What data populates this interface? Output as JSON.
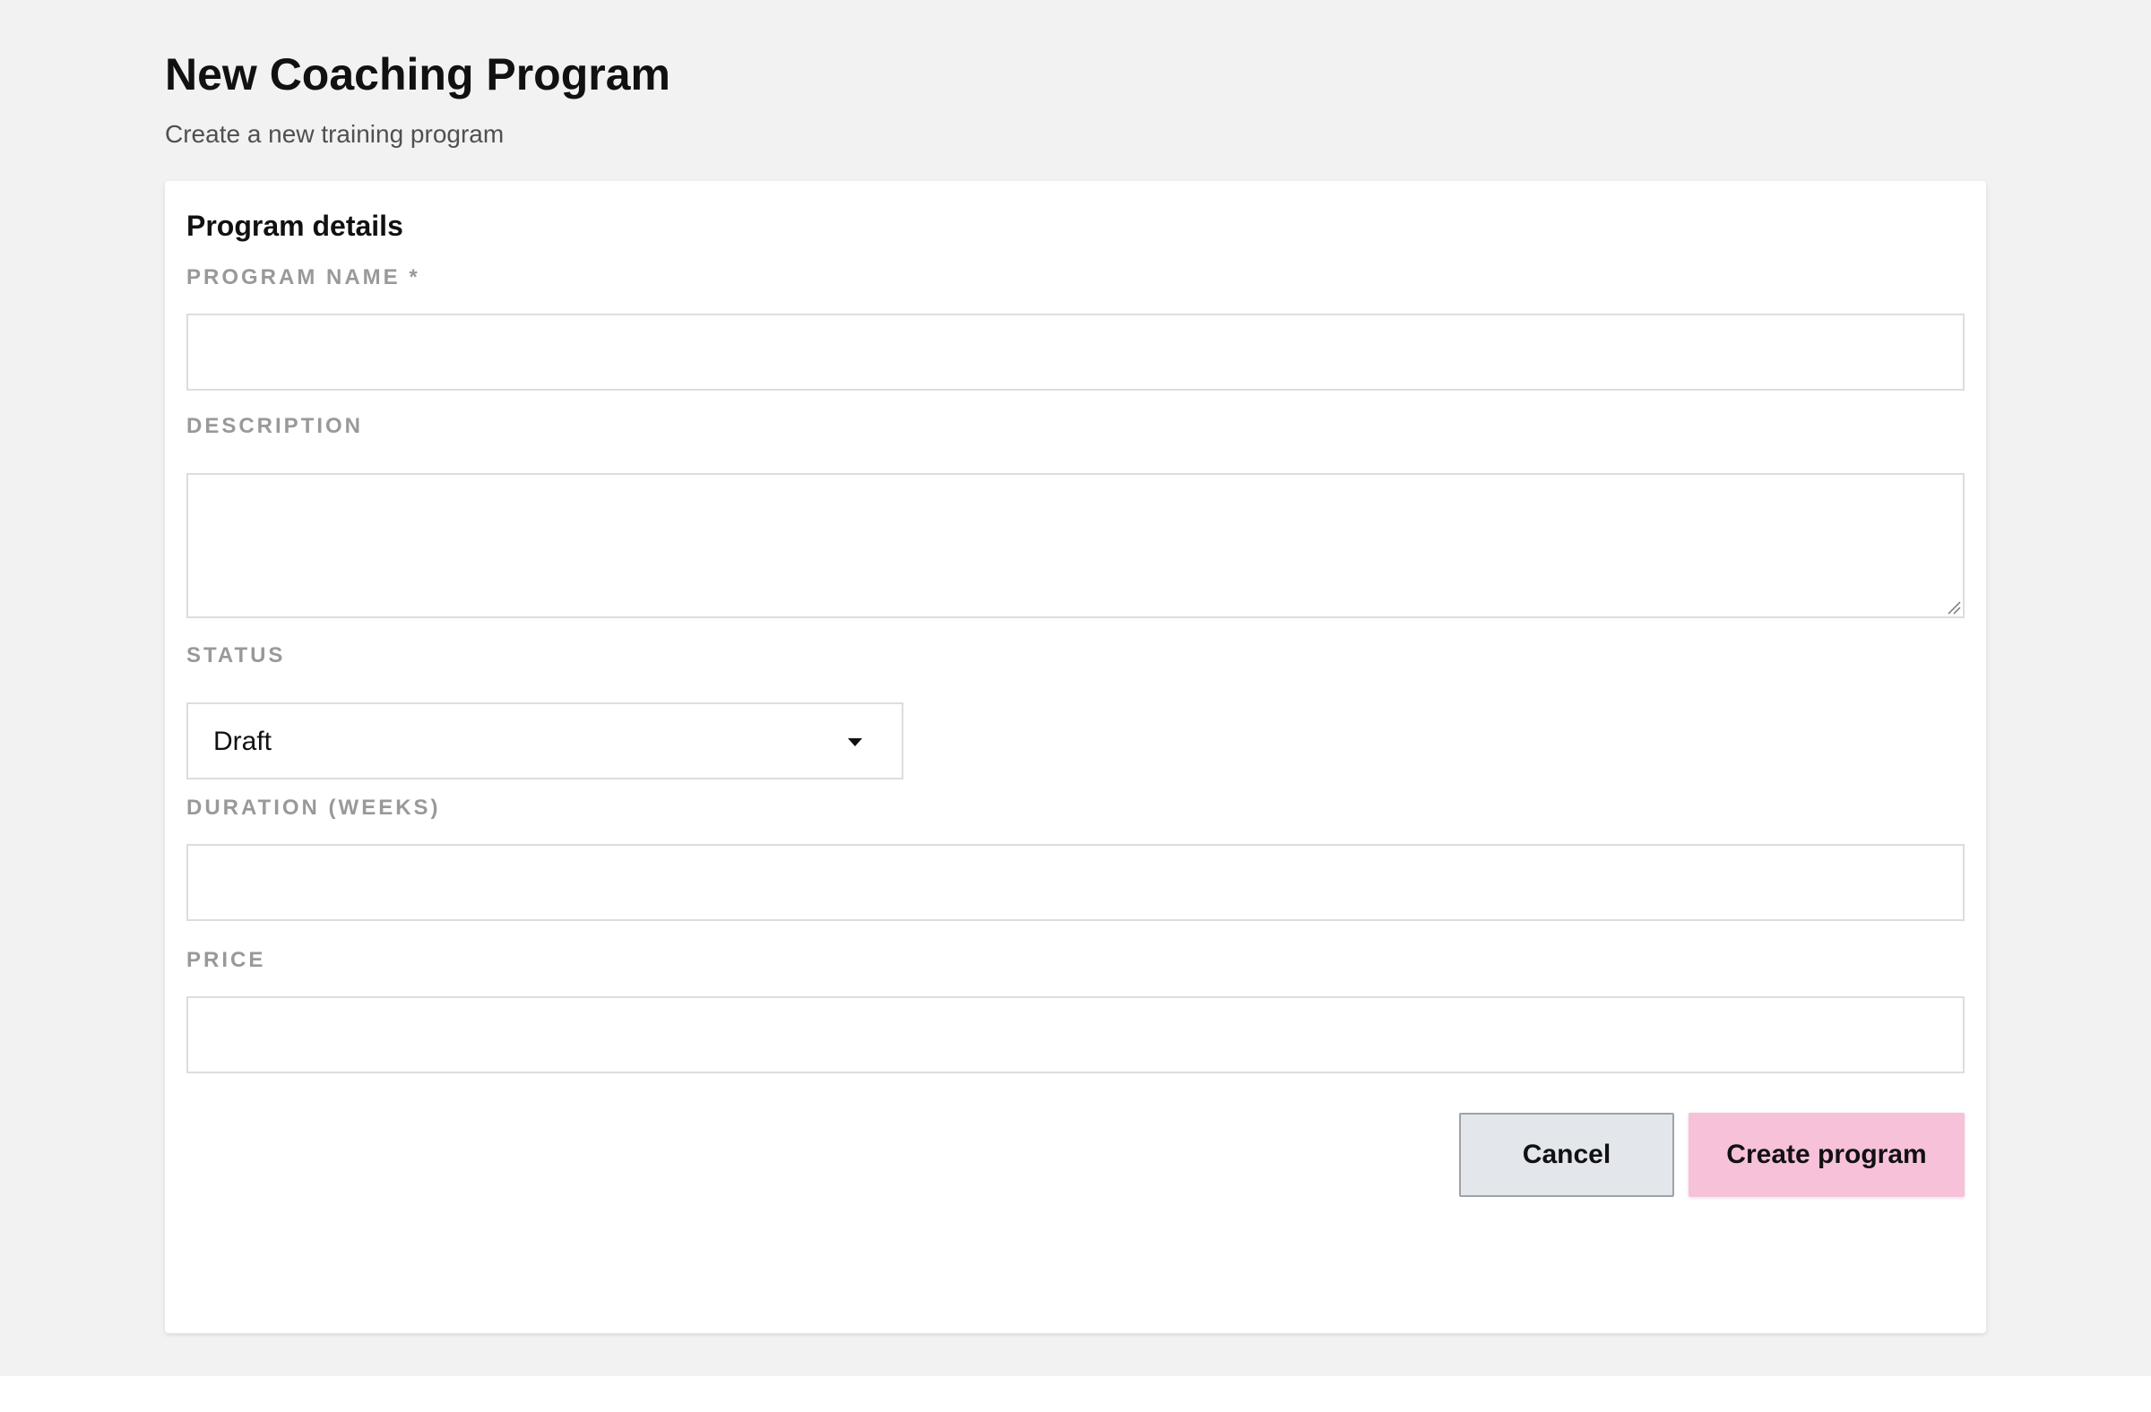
{
  "header": {
    "title": "New Coaching Program",
    "subtitle": "Create a new training program"
  },
  "form": {
    "section_title": "Program details",
    "program_name": {
      "label": "PROGRAM NAME *",
      "value": ""
    },
    "description": {
      "label": "DESCRIPTION",
      "value": ""
    },
    "status": {
      "label": "STATUS",
      "selected": "Draft"
    },
    "duration": {
      "label": "DURATION (WEEKS)",
      "value": ""
    },
    "price": {
      "label": "PRICE",
      "value": ""
    }
  },
  "actions": {
    "cancel_label": "Cancel",
    "create_label": "Create program"
  },
  "icons": {
    "status_dropdown": "chevron-down-icon",
    "description_resize": "resize-handle-icon"
  },
  "colors": {
    "page_background": "#f2f2f2",
    "card_background": "#ffffff",
    "cancel_button": "#e3e6ea",
    "create_button": "#f7c1da",
    "label_text": "#999999"
  }
}
